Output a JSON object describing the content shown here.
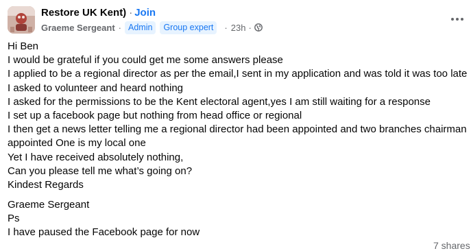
{
  "post": {
    "group_name": "Restore UK Kent)",
    "separator": "·",
    "join_label": "Join",
    "author": "Graeme Sergeant",
    "badges": [
      "Admin",
      "Group expert"
    ],
    "time": "23h",
    "privacy_icon": "globe-icon",
    "more_icon": "more-options-icon",
    "paragraph1": [
      "Hi Ben",
      "I would be grateful if you could get me some answers please",
      "I applied to be a regional director as per the email,I sent in my application and was told it was too late",
      "I asked to volunteer and heard nothing",
      "I asked for the permissions to be the Kent electoral agent,yes I am still waiting for a response",
      "I set up a facebook page but nothing from head office or regional",
      "I then get a news letter telling me a regional director had been appointed and two branches chairman",
      "appointed One is my local one",
      "Yet I have received absolutely nothing,",
      "Can you please tell me what’s going on?",
      "Kindest Regards"
    ],
    "paragraph2": [
      "Graeme Sergeant",
      "Ps",
      "I have paused the Facebook page for now"
    ],
    "shares": "7 shares"
  },
  "colors": {
    "link_blue": "#1877f2",
    "secondary_text": "#65676b",
    "badge_bg": "#e7f3ff",
    "text": "#050505"
  }
}
